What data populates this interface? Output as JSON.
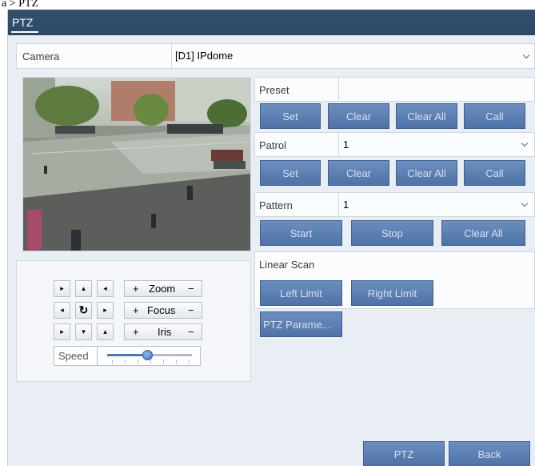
{
  "breadcrumb": "a > PTZ",
  "window": {
    "title": "PTZ"
  },
  "camera": {
    "label": "Camera",
    "value": "[D1] IPdome"
  },
  "preset": {
    "label": "Preset",
    "value": "",
    "buttons": {
      "set": "Set",
      "clear": "Clear",
      "clear_all": "Clear All",
      "call": "Call"
    }
  },
  "patrol": {
    "label": "Patrol",
    "value": "1",
    "buttons": {
      "set": "Set",
      "clear": "Clear",
      "clear_all": "Clear All",
      "call": "Call"
    }
  },
  "pattern": {
    "label": "Pattern",
    "value": "1",
    "buttons": {
      "start": "Start",
      "stop": "Stop",
      "clear_all": "Clear All"
    }
  },
  "linear_scan": {
    "label": "Linear Scan",
    "buttons": {
      "left_limit": "Left Limit",
      "right_limit": "Right Limit"
    }
  },
  "ptz_params_button": "PTZ Parame...",
  "control": {
    "arrows": {
      "up_left": "▸",
      "up": "▴",
      "up_right": "◂",
      "left": "◂",
      "center": "↻",
      "right": "▸",
      "down_left": "▸",
      "down": "▾",
      "down_right": "▴"
    },
    "zoom": {
      "plus": "+",
      "label": "Zoom",
      "minus": "−"
    },
    "focus": {
      "plus": "+",
      "label": "Focus",
      "minus": "−"
    },
    "iris": {
      "plus": "+",
      "label": "Iris",
      "minus": "−"
    },
    "speed": {
      "label": "Speed",
      "level": 0.48
    }
  },
  "footer": {
    "ptz": "PTZ",
    "back": "Back"
  },
  "colors": {
    "titlebar": "#2c4866",
    "button": "#5a7db2",
    "panel": "#e9eef4",
    "accent": "#4b79b8"
  }
}
